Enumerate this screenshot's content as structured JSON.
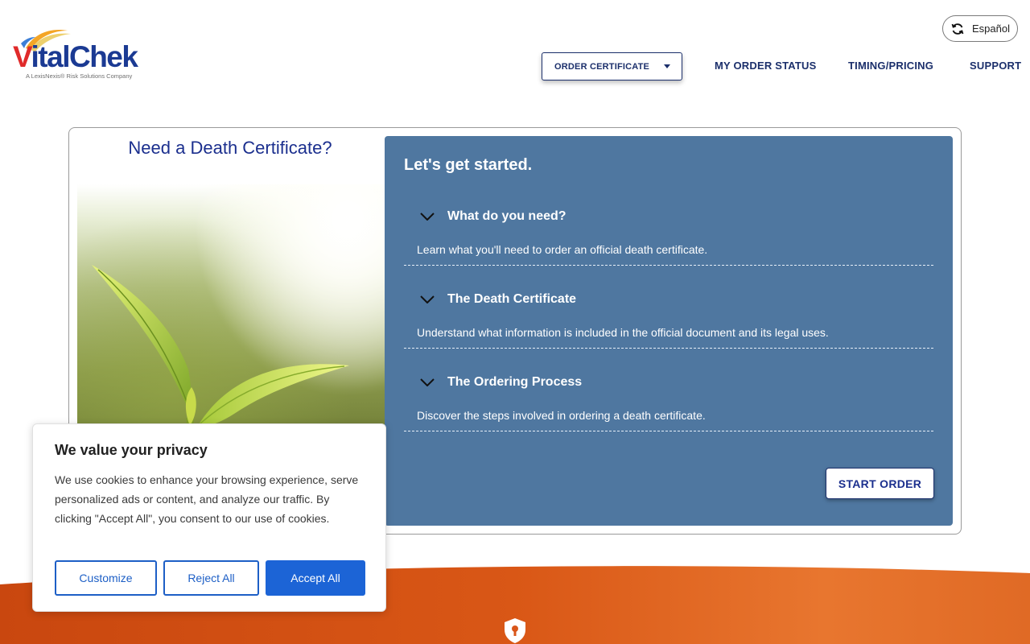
{
  "brand": {
    "name_first": "V",
    "name_rest": "italChek",
    "tagline": "A LexisNexis® Risk Solutions Company"
  },
  "header": {
    "language_button": "Español",
    "nav": {
      "order_certificate": "ORDER CERTIFICATE",
      "my_order_status": "MY ORDER STATUS",
      "timing_pricing": "TIMING/PRICING",
      "support": "SUPPORT"
    }
  },
  "main": {
    "left_title": "Need a Death Certificate?",
    "panel_title": "Let's get started.",
    "accordion": [
      {
        "title": "What do you need?",
        "description": "Learn what you'll need to order an official death certificate."
      },
      {
        "title": "The Death Certificate",
        "description": "Understand what information is included in the official document and its legal uses."
      },
      {
        "title": "The Ordering Process",
        "description": "Discover the steps involved in ordering a death certificate."
      }
    ],
    "start_button": "START ORDER"
  },
  "cookie_banner": {
    "title": "We value your privacy",
    "text": "We use cookies to enhance your browsing experience, serve personalized ads or content, and analyze our traffic. By clicking \"Accept All\", you consent to our use of cookies.",
    "customize": "Customize",
    "reject_all": "Reject All",
    "accept_all": "Accept All"
  },
  "colors": {
    "brand_navy": "#1b2f6b",
    "panel_blue": "#4f77a0",
    "accent_orange": "#d9561a",
    "cookie_blue": "#1c64d6"
  }
}
